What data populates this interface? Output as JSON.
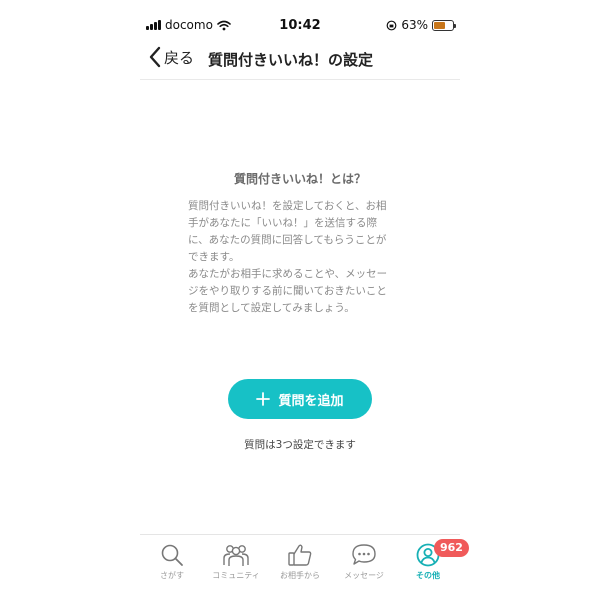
{
  "status_bar": {
    "carrier": "docomo",
    "time": "10:42",
    "battery": "63%",
    "battery_level": 0.63
  },
  "nav": {
    "back_label": "戻る",
    "title": "質問付きいいね！の設定"
  },
  "about": {
    "title": "質問付きいいね！とは？",
    "paragraph1": "質問付きいいね！を設定しておくと、お相\n手があなたに「いいね！」を送信する際\nに、あなたの質問に回答してもらうことが\nできます。",
    "paragraph2": "あなたがお相手に求めることや、メッセー\nジをやり取りする前に聞いておきたいこと\nを質問として設定してみましょう。"
  },
  "add_question": {
    "button_label": "質問を追加",
    "note": "質問は3つ設定できます"
  },
  "tabbar": {
    "items": [
      {
        "label": "さがす",
        "icon": "search-icon"
      },
      {
        "label": "コミュニティ",
        "icon": "community-icon"
      },
      {
        "label": "お相手から",
        "icon": "thumbs-up-icon"
      },
      {
        "label": "メッセージ",
        "icon": "message-icon"
      },
      {
        "label": "その他",
        "icon": "profile-icon",
        "badge": "962",
        "active": true
      }
    ]
  },
  "colors": {
    "accent": "#17c1c6",
    "badge": "#f05a5a",
    "battery": "#c8761a"
  }
}
